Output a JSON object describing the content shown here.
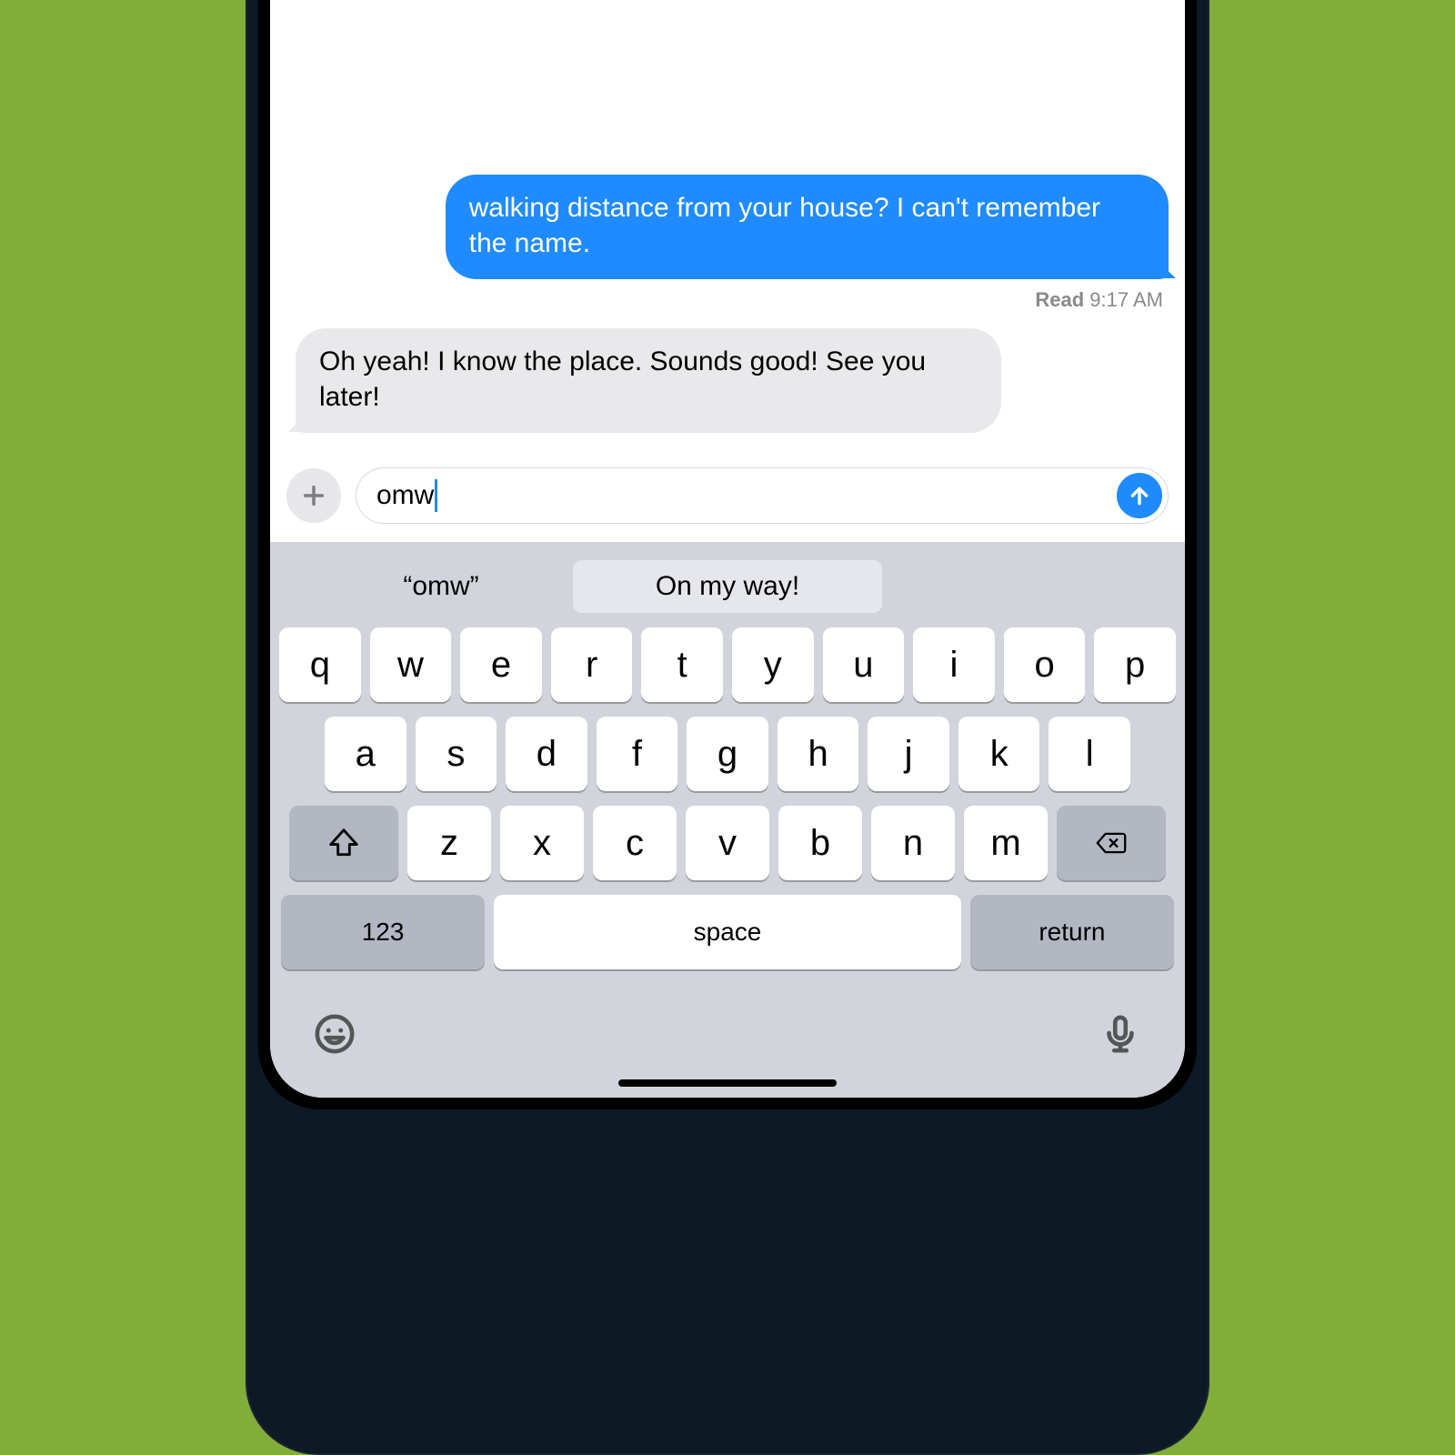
{
  "conversation": {
    "sent_message": "walking distance from your house? I can't remember the name.",
    "read_label": "Read",
    "read_time": "9:17 AM",
    "received_message": "Oh yeah! I know the place. Sounds good! See you later!"
  },
  "compose": {
    "value": "omw"
  },
  "suggestions": {
    "literal": "“omw”",
    "replacement": "On my way!"
  },
  "keyboard": {
    "row1": [
      "q",
      "w",
      "e",
      "r",
      "t",
      "y",
      "u",
      "i",
      "o",
      "p"
    ],
    "row2": [
      "a",
      "s",
      "d",
      "f",
      "g",
      "h",
      "j",
      "k",
      "l"
    ],
    "row3": [
      "z",
      "x",
      "c",
      "v",
      "b",
      "n",
      "m"
    ],
    "numbers_label": "123",
    "space_label": "space",
    "return_label": "return"
  }
}
